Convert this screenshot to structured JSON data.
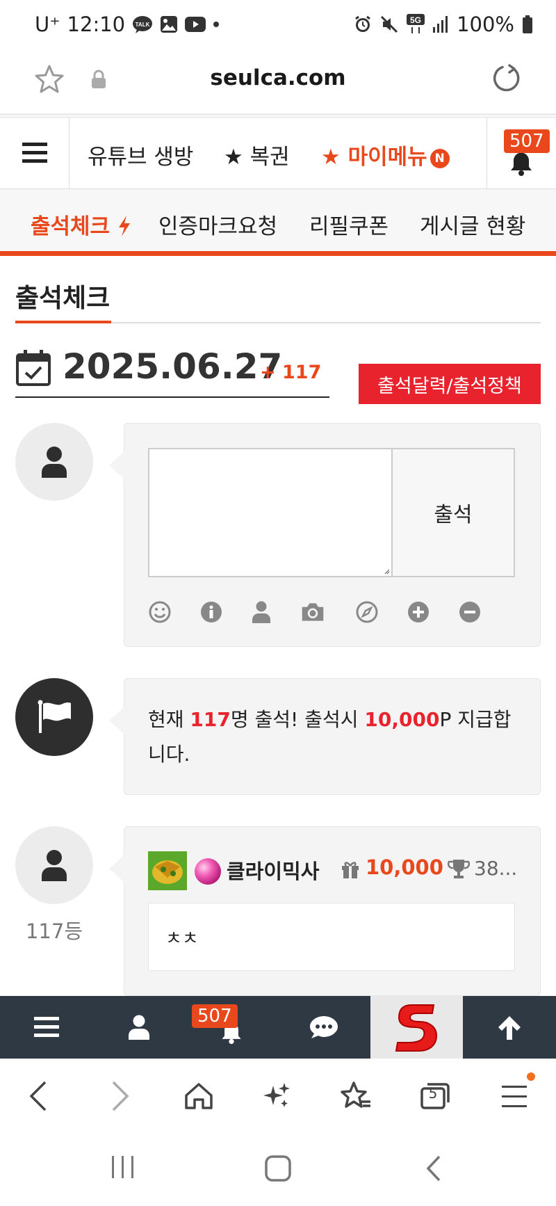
{
  "status_bar": {
    "carrier": "U⁺",
    "time": "12:10",
    "network": "5G",
    "battery": "100%"
  },
  "url_bar": {
    "url": "seulca.com"
  },
  "site_header": {
    "nav_items": [
      "유튜브 생방",
      "★ 복권",
      "★ 마이메뉴"
    ],
    "new_badge": "N",
    "notification_count": "507"
  },
  "tabs": [
    "출석체크",
    "인증마크요청",
    "리필쿠폰",
    "게시글 현황"
  ],
  "section": {
    "title": "출석체크",
    "date": "2025.06.27",
    "date_delta": "+ 117",
    "calendar_button": "출석달력/출석정책"
  },
  "attend_form": {
    "submit_label": "출석",
    "toolbar_icons": [
      "smile-icon",
      "info-icon",
      "user-icon",
      "camera-icon",
      "compass-icon",
      "plus-circle-icon",
      "minus-circle-icon"
    ]
  },
  "info": {
    "prefix": "현재 ",
    "count": "117",
    "middle": "명 출석! 출석시 ",
    "points": "10,000",
    "suffix": "P 지급합니다."
  },
  "entry": {
    "rank": "117등",
    "username": "클라이믹사",
    "points": "10,000",
    "trophy": "38...",
    "comment": "ㅊㅊ"
  },
  "site_footer": {
    "notification_count": "507"
  },
  "browser_nav": {
    "tab_count": "5"
  },
  "colors": {
    "accent": "#e8481c",
    "highlight": "#e8232e",
    "footer_bg": "#2f3944"
  }
}
